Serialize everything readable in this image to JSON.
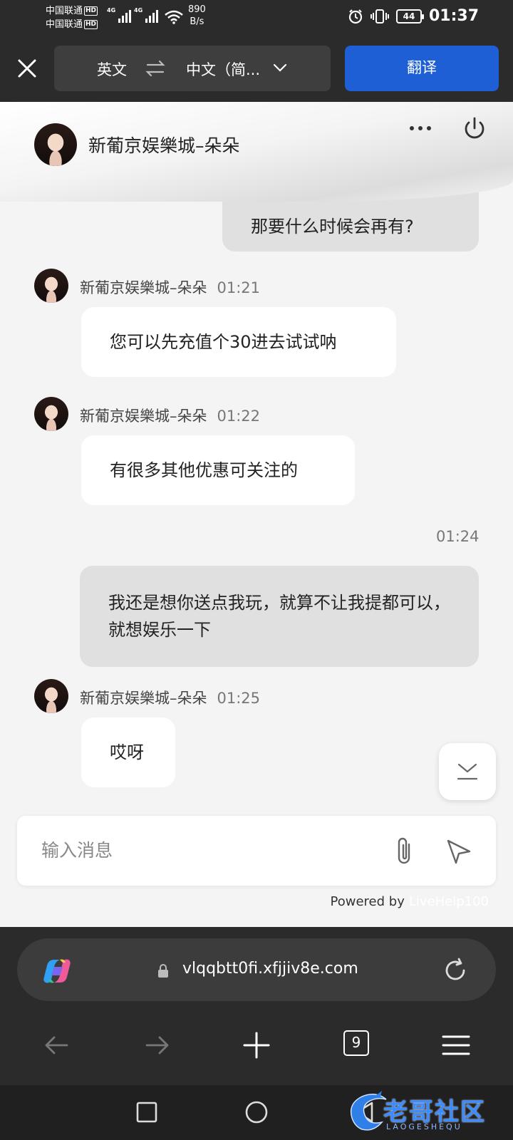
{
  "status_bar": {
    "carrier1": "中国联通",
    "carrier2": "中国联通",
    "hd": "HD",
    "net_type": "4G",
    "net_speed_value": "890",
    "net_speed_unit": "B/s",
    "battery": "44",
    "time": "01:37"
  },
  "translate_bar": {
    "source_lang": "英文",
    "target_lang": "中文（简...",
    "translate_button": "翻译"
  },
  "chat": {
    "agent_name": "新葡京娱樂城–朵朵",
    "input_placeholder": "输入消息",
    "powered_by": "Powered by",
    "powered_brand": "LiveHelp100",
    "messages": [
      {
        "from": "user",
        "text": "那要什么时候会再有?"
      },
      {
        "from": "agent",
        "name": "新葡京娱樂城–朵朵",
        "time": "01:21",
        "text": "您可以先充值个30进去试试呐"
      },
      {
        "from": "agent",
        "name": "新葡京娱樂城–朵朵",
        "time": "01:22",
        "text": "有很多其他优惠可关注的"
      },
      {
        "from": "user",
        "time": "01:24",
        "text": "我还是想你送点我玩，就算不让我提都可以，就想娱乐一下"
      },
      {
        "from": "agent",
        "name": "新葡京娱樂城–朵朵",
        "time": "01:25",
        "text": "哎呀"
      }
    ]
  },
  "browser": {
    "url": "vlqqbtt0fi.xfjjiv8e.com",
    "tab_count": "9"
  },
  "watermark": {
    "text": "老哥社区",
    "sub": "LAOGESHEQU"
  }
}
